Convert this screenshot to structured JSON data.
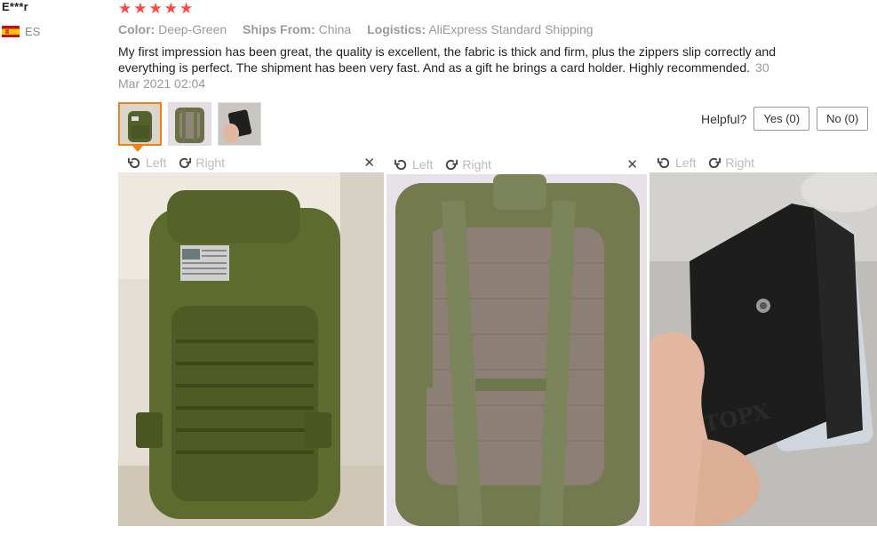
{
  "user": {
    "name": "E***r",
    "country_code": "ES"
  },
  "rating": {
    "stars": 5
  },
  "meta": {
    "color_label": "Color:",
    "color_value": "Deep-Green",
    "ships_label": "Ships From:",
    "ships_value": "China",
    "logistics_label": "Logistics:",
    "logistics_value": "AliExpress Standard Shipping"
  },
  "review": {
    "text": "My first impression has been great, the quality is excellent, the fabric is thick and firm, plus the zippers slip correctly and everything is perfect. The shipment has been very fast. And as a gift he brings a card holder. Highly recommended.",
    "date": "30 Mar 2021 02:04"
  },
  "helpful": {
    "label": "Helpful?",
    "yes_label": "Yes (0)",
    "no_label": "No (0)"
  },
  "panels": [
    {
      "left_label": "Left",
      "right_label": "Right",
      "close": "✕",
      "photo": "backpack-front-photo"
    },
    {
      "left_label": "Left",
      "right_label": "Right",
      "close": "✕",
      "photo": "backpack-back-photo"
    },
    {
      "left_label": "Left",
      "right_label": "Right",
      "close": "",
      "photo": "card-holder-photo"
    }
  ],
  "photo_text": {
    "card_brand": "TOPX"
  },
  "colors": {
    "accent": "#e8831a",
    "star": "#ff4747",
    "olive": "#5e6b2e"
  }
}
